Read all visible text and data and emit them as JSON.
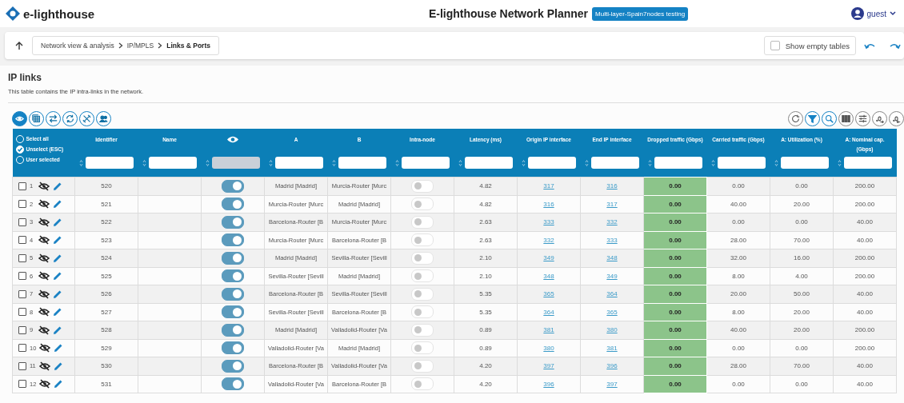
{
  "app": {
    "logo": "e-lighthouse",
    "title": "E-lighthouse Network Planner",
    "design_badge": "Multi-layer-Spain7nodes testing",
    "user": "guest"
  },
  "breadcrumb": [
    "Network view & analysis",
    "IP/MPLS",
    "Links & Ports"
  ],
  "show_empty_tables": {
    "label": "Show empty tables",
    "checked": false
  },
  "section": {
    "title": "IP links",
    "description": "This table contains the IP intra-links in the network."
  },
  "view_tools": [
    {
      "kind": "eye",
      "selected": true
    },
    {
      "kind": "table",
      "selected": false
    },
    {
      "kind": "swap",
      "selected": false
    },
    {
      "kind": "sync",
      "selected": false
    },
    {
      "kind": "tools",
      "selected": false
    },
    {
      "kind": "users",
      "selected": false
    }
  ],
  "table_tools": [
    {
      "kind": "refresh",
      "highlighted": false
    },
    {
      "kind": "filter",
      "highlighted": true
    },
    {
      "kind": "search",
      "highlighted": true
    },
    {
      "kind": "columns",
      "highlighted": false
    },
    {
      "kind": "sliders",
      "highlighted": false
    },
    {
      "kind": "more-decimals",
      "highlighted": false
    },
    {
      "kind": "less-decimals",
      "highlighted": false
    }
  ],
  "selection_options": [
    {
      "label": "Select all",
      "selected": false
    },
    {
      "label": "Unselect (ESC)",
      "selected": true
    },
    {
      "label": "User selected",
      "selected": false
    }
  ],
  "columns": [
    {
      "kind": "text",
      "label": "Identifier",
      "disabled": false
    },
    {
      "kind": "text",
      "label": "Name",
      "disabled": false
    },
    {
      "kind": "icon",
      "disabled": true
    },
    {
      "kind": "text",
      "label": "A",
      "disabled": false
    },
    {
      "kind": "text",
      "label": "B",
      "disabled": false
    },
    {
      "kind": "text",
      "label": "Intra-node",
      "disabled": false
    },
    {
      "kind": "text",
      "label": "Latency (ms)",
      "disabled": false
    },
    {
      "kind": "text",
      "label": "Origin IP interface",
      "disabled": false
    },
    {
      "kind": "text",
      "label": "End IP interface",
      "disabled": false
    },
    {
      "kind": "text",
      "label": "Dropped traffic (Gbps)",
      "disabled": false
    },
    {
      "kind": "text",
      "label": "Carried traffic (Gbps)",
      "disabled": false
    },
    {
      "kind": "text",
      "label": "A: Utilization (%)",
      "disabled": false
    },
    {
      "kind": "text",
      "label": "A: Nominal cap. (Gbps)",
      "disabled": false
    }
  ],
  "rows": [
    {
      "index": "1",
      "checked": false,
      "id": "520",
      "visible": true,
      "a": "Madrid [Madrid]",
      "b": "Murcia-Router [Murc",
      "intra_node": false,
      "latency": "4.82",
      "origin": "317",
      "end": "316",
      "dropped": "0.00",
      "carried": "0.00",
      "utilization": "0.00",
      "capacity": "200.00"
    },
    {
      "index": "2",
      "checked": false,
      "id": "521",
      "visible": true,
      "a": "Murcia-Router [Murc",
      "b": "Madrid [Madrid]",
      "intra_node": false,
      "latency": "4.82",
      "origin": "316",
      "end": "317",
      "dropped": "0.00",
      "carried": "40.00",
      "utilization": "20.00",
      "capacity": "200.00"
    },
    {
      "index": "3",
      "checked": false,
      "id": "522",
      "visible": true,
      "a": "Barcelona-Router [B",
      "b": "Murcia-Router [Murc",
      "intra_node": false,
      "latency": "2.63",
      "origin": "333",
      "end": "332",
      "dropped": "0.00",
      "carried": "0.00",
      "utilization": "0.00",
      "capacity": "40.00"
    },
    {
      "index": "4",
      "checked": false,
      "id": "523",
      "visible": true,
      "a": "Murcia-Router [Murc",
      "b": "Barcelona-Router [B",
      "intra_node": false,
      "latency": "2.63",
      "origin": "332",
      "end": "333",
      "dropped": "0.00",
      "carried": "28.00",
      "utilization": "70.00",
      "capacity": "40.00"
    },
    {
      "index": "5",
      "checked": false,
      "id": "524",
      "visible": true,
      "a": "Madrid [Madrid]",
      "b": "Sevilla-Router [Sevill",
      "intra_node": false,
      "latency": "2.10",
      "origin": "349",
      "end": "348",
      "dropped": "0.00",
      "carried": "32.00",
      "utilization": "16.00",
      "capacity": "200.00"
    },
    {
      "index": "6",
      "checked": false,
      "id": "525",
      "visible": true,
      "a": "Sevilla-Router [Sevill",
      "b": "Madrid [Madrid]",
      "intra_node": false,
      "latency": "2.10",
      "origin": "348",
      "end": "349",
      "dropped": "0.00",
      "carried": "8.00",
      "utilization": "4.00",
      "capacity": "200.00"
    },
    {
      "index": "7",
      "checked": false,
      "id": "526",
      "visible": true,
      "a": "Barcelona-Router [B",
      "b": "Sevilla-Router [Sevill",
      "intra_node": false,
      "latency": "5.35",
      "origin": "365",
      "end": "364",
      "dropped": "0.00",
      "carried": "20.00",
      "utilization": "50.00",
      "capacity": "40.00"
    },
    {
      "index": "8",
      "checked": false,
      "id": "527",
      "visible": true,
      "a": "Sevilla-Router [Sevill",
      "b": "Barcelona-Router [B",
      "intra_node": false,
      "latency": "5.35",
      "origin": "364",
      "end": "365",
      "dropped": "0.00",
      "carried": "8.00",
      "utilization": "20.00",
      "capacity": "40.00"
    },
    {
      "index": "9",
      "checked": false,
      "id": "528",
      "visible": true,
      "a": "Madrid [Madrid]",
      "b": "Valladolid-Router [Va",
      "intra_node": false,
      "latency": "0.89",
      "origin": "381",
      "end": "380",
      "dropped": "0.00",
      "carried": "40.00",
      "utilization": "20.00",
      "capacity": "200.00"
    },
    {
      "index": "10",
      "checked": false,
      "id": "529",
      "visible": true,
      "a": "Valladolid-Router [Va",
      "b": "Madrid [Madrid]",
      "intra_node": false,
      "latency": "0.89",
      "origin": "380",
      "end": "381",
      "dropped": "0.00",
      "carried": "0.00",
      "utilization": "0.00",
      "capacity": "200.00"
    },
    {
      "index": "11",
      "checked": false,
      "id": "530",
      "visible": true,
      "a": "Barcelona-Router [B",
      "b": "Valladolid-Router [Va",
      "intra_node": false,
      "latency": "4.20",
      "origin": "397",
      "end": "396",
      "dropped": "0.00",
      "carried": "28.00",
      "utilization": "70.00",
      "capacity": "40.00"
    },
    {
      "index": "12",
      "checked": false,
      "id": "531",
      "visible": true,
      "a": "Valladolid-Router [Va",
      "b": "Barcelona-Router [B",
      "intra_node": false,
      "latency": "4.20",
      "origin": "396",
      "end": "397",
      "dropped": "0.00",
      "carried": "0.00",
      "utilization": "0.00",
      "capacity": "40.00"
    }
  ]
}
